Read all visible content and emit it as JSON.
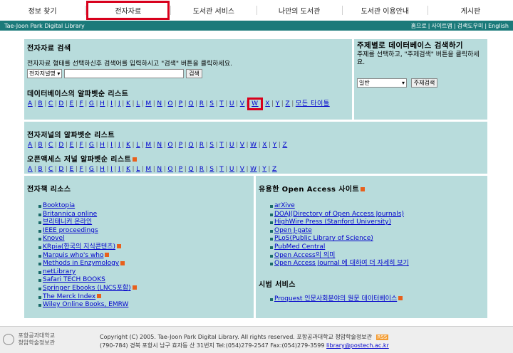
{
  "nav": [
    {
      "label": "정보 찾기",
      "active": false
    },
    {
      "label": "전자자료",
      "active": true
    },
    {
      "label": "도서관 서비스",
      "active": false
    },
    {
      "label": "나만의 도서관",
      "active": false
    },
    {
      "label": "도서관 이용안내",
      "active": false
    },
    {
      "label": "게시판",
      "active": false
    }
  ],
  "greenbar": {
    "title": "Tae-Joon Park Digital Library",
    "links": [
      "홈으로",
      "사이트맵",
      "검색도우미",
      "English"
    ]
  },
  "search": {
    "heading": "전자자료 검색",
    "instruction": "전자자료 형태를 선택하신후 검색어를 입력하시고 \"검색\" 버튼을 클릭하세요.",
    "select_value": "전자저널명",
    "button": "검색"
  },
  "subject": {
    "heading": "주제별로 데이터베이스 검색하기",
    "instruction": "주제를 선택하고, \"주제검색\" 버튼을 클릭하세요.",
    "select_value": "일반",
    "button": "주제검색"
  },
  "db_alpha": {
    "heading": "데이터베이스의 알파벳순 리스트",
    "letters": [
      "A",
      "B",
      "C",
      "D",
      "E",
      "F",
      "G",
      "H",
      "I",
      "J",
      "K",
      "L",
      "M",
      "N",
      "O",
      "P",
      "Q",
      "R",
      "S",
      "T",
      "U",
      "V",
      "W",
      "X",
      "Y",
      "Z"
    ],
    "all_titles": "모든 타이틀",
    "highlight": "W"
  },
  "journal_alpha": {
    "heading": "전자저널의 알파벳순 리스트",
    "letters": [
      "A",
      "B",
      "C",
      "D",
      "E",
      "F",
      "G",
      "H",
      "I",
      "J",
      "K",
      "L",
      "M",
      "N",
      "O",
      "P",
      "Q",
      "R",
      "S",
      "T",
      "U",
      "V",
      "W",
      "X",
      "Y",
      "Z"
    ]
  },
  "oa_alpha": {
    "heading": "오픈액세스 저널 알파벳순 리스트",
    "letters": [
      "A",
      "B",
      "C",
      "D",
      "E",
      "F",
      "G",
      "H",
      "I",
      "J",
      "K",
      "L",
      "M",
      "N",
      "O",
      "P",
      "Q",
      "R",
      "S",
      "T",
      "U",
      "V",
      "W",
      "Y",
      "Z"
    ]
  },
  "ebooks": {
    "heading": "전자책 리소스",
    "items": [
      {
        "label": "Booktopia",
        "rss": false
      },
      {
        "label": "Britannica online",
        "rss": false
      },
      {
        "label": "브리태니커 온라인",
        "rss": false
      },
      {
        "label": "IEEE proceedings",
        "rss": false
      },
      {
        "label": "Knovel",
        "rss": false
      },
      {
        "label": "KRpia(한국의 지식콘텐츠)",
        "rss": true
      },
      {
        "label": "Marquis who's who",
        "rss": true
      },
      {
        "label": "Methods in Enzymology",
        "rss": true
      },
      {
        "label": "netLibrary",
        "rss": false
      },
      {
        "label": "Safari TECH BOOKS",
        "rss": false
      },
      {
        "label": "Springer Ebooks (LNCS포함)",
        "rss": true
      },
      {
        "label": "The Merck Index",
        "rss": true
      },
      {
        "label": "Wiley Online Books, EMRW",
        "rss": false
      }
    ]
  },
  "oa_sites": {
    "heading": "유용한 Open Access 사이트",
    "items": [
      "arXive",
      "DOAJ(Directory of Open Access Journals)",
      "HighWire Press (Stanford University)",
      "Open J-gate",
      "PLoS(Public Library of Science)",
      "PubMed Central",
      "Open Access의 의미",
      "Open Access Journal 에 대하여 더 자세히 보기"
    ]
  },
  "trial": {
    "heading": "시범 서비스",
    "items": [
      {
        "label": "Proquest 인문사회분야의 원문 데이터베이스",
        "rss": true
      }
    ]
  },
  "footer": {
    "logo_line1": "포항공과대학교",
    "logo_line2": "청암학술정보관",
    "copyright": "Copyright (C) 2005. Tae-Joon Park Digital Library. All rights reserved. 포항공과대학교 청암학술정보관",
    "address": "(790-784) 경북 포항시 남구 효자동 산 31번지 Tel:(054)279-2547 Fax:(054)279-3599",
    "email": "library@postech.ac.kr",
    "rss_label": "RSS"
  }
}
